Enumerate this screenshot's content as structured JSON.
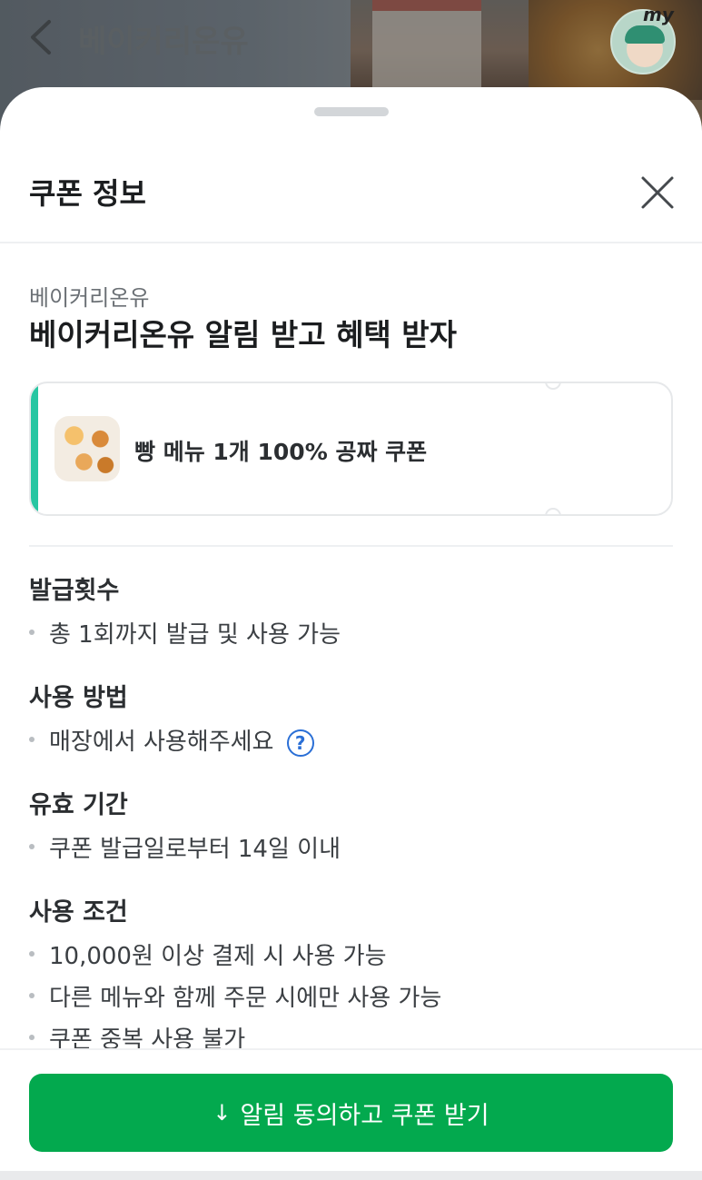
{
  "background": {
    "store_title": "베이커리온유",
    "my_label": "my"
  },
  "sheet": {
    "title": "쿠폰 정보"
  },
  "promo": {
    "brand": "베이커리온유",
    "title": "베이커리온유 알림 받고 혜택 받자"
  },
  "coupon": {
    "text": "빵 메뉴 1개 100% 공짜 쿠폰",
    "accent_color": "#27c6a2"
  },
  "sections": [
    {
      "heading": "발급횟수",
      "items": [
        "총 1회까지 발급 및 사용 가능"
      ]
    },
    {
      "heading": "사용 방법",
      "items": [
        "매장에서 사용해주세요"
      ],
      "help_icon": "?"
    },
    {
      "heading": "유효 기간",
      "items": [
        "쿠폰 발급일로부터 14일 이내"
      ]
    },
    {
      "heading": "사용 조건",
      "items": [
        "10,000원 이상 결제 시 사용 가능",
        "다른 메뉴와 함께 주문 시에만 사용 가능",
        "쿠폰 중복 사용 불가"
      ]
    }
  ],
  "cta": {
    "icon": "↓",
    "label": "알림 동의하고 쿠폰 받기",
    "color": "#03a94e"
  }
}
